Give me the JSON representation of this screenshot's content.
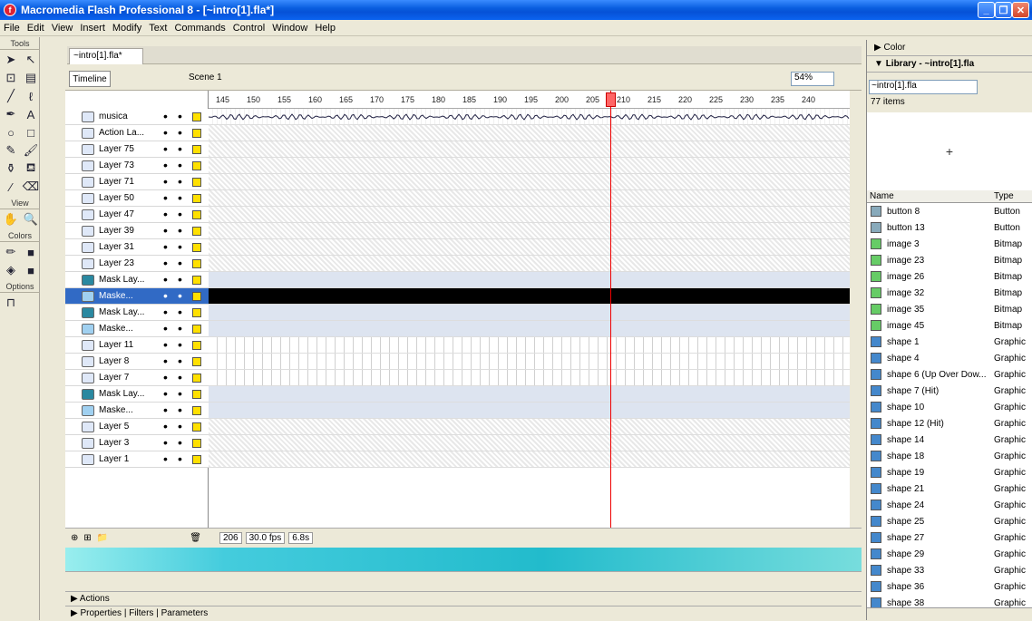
{
  "window": {
    "title": "Macromedia Flash Professional 8 - [~intro[1].fla*]"
  },
  "menu": [
    "File",
    "Edit",
    "View",
    "Insert",
    "Modify",
    "Text",
    "Commands",
    "Control",
    "Window",
    "Help"
  ],
  "tools": {
    "header": "Tools",
    "view_label": "View",
    "colors_label": "Colors",
    "options_label": "Options"
  },
  "doc": {
    "tab": "~intro[1].fla*",
    "timeline_btn": "Timeline",
    "scene": "Scene 1",
    "zoom": "54%"
  },
  "ruler": [
    "145",
    "150",
    "155",
    "160",
    "165",
    "170",
    "175",
    "180",
    "185",
    "190",
    "195",
    "200",
    "205",
    "210",
    "215",
    "220",
    "225",
    "230",
    "235",
    "240"
  ],
  "layers": [
    {
      "name": "musica",
      "kind": "normal"
    },
    {
      "name": "Action La...",
      "kind": "normal"
    },
    {
      "name": "Layer 75",
      "kind": "normal"
    },
    {
      "name": "Layer 73",
      "kind": "normal"
    },
    {
      "name": "Layer 71",
      "kind": "normal"
    },
    {
      "name": "Layer 50",
      "kind": "normal"
    },
    {
      "name": "Layer 47",
      "kind": "normal"
    },
    {
      "name": "Layer 39",
      "kind": "normal"
    },
    {
      "name": "Layer 31",
      "kind": "normal"
    },
    {
      "name": "Layer 23",
      "kind": "normal"
    },
    {
      "name": "Mask Lay...",
      "kind": "mask"
    },
    {
      "name": "Maske...",
      "kind": "masked",
      "selected": true
    },
    {
      "name": "Mask Lay...",
      "kind": "mask"
    },
    {
      "name": "Maske...",
      "kind": "masked"
    },
    {
      "name": "Layer 11",
      "kind": "normal"
    },
    {
      "name": "Layer 8",
      "kind": "normal"
    },
    {
      "name": "Layer 7",
      "kind": "normal"
    },
    {
      "name": "Mask Lay...",
      "kind": "mask"
    },
    {
      "name": "Maske...",
      "kind": "masked"
    },
    {
      "name": "Layer 5",
      "kind": "normal"
    },
    {
      "name": "Layer 3",
      "kind": "normal"
    },
    {
      "name": "Layer 1",
      "kind": "normal"
    }
  ],
  "timeline_footer": {
    "frame": "206",
    "fps": "30.0 fps",
    "time": "6.8s"
  },
  "panels": {
    "actions": "Actions",
    "properties": "Properties",
    "filters": "Filters",
    "parameters": "Parameters"
  },
  "right": {
    "color_hdr": "Color",
    "lib_hdr": "Library - ~intro[1].fla",
    "lib_select": "~intro[1].fla",
    "count": "77 items",
    "col_name": "Name",
    "col_type": "Type",
    "items": [
      {
        "name": "button 8",
        "type": "Button",
        "k": "btn"
      },
      {
        "name": "button 13",
        "type": "Button",
        "k": "btn"
      },
      {
        "name": "image 3",
        "type": "Bitmap",
        "k": "bmp"
      },
      {
        "name": "image 23",
        "type": "Bitmap",
        "k": "bmp"
      },
      {
        "name": "image 26",
        "type": "Bitmap",
        "k": "bmp"
      },
      {
        "name": "image 32",
        "type": "Bitmap",
        "k": "bmp"
      },
      {
        "name": "image 35",
        "type": "Bitmap",
        "k": "bmp"
      },
      {
        "name": "image 45",
        "type": "Bitmap",
        "k": "bmp"
      },
      {
        "name": "shape 1",
        "type": "Graphic",
        "k": "gfx"
      },
      {
        "name": "shape 4",
        "type": "Graphic",
        "k": "gfx"
      },
      {
        "name": "shape 6 (Up Over Dow...",
        "type": "Graphic",
        "k": "gfx"
      },
      {
        "name": "shape 7 (Hit)",
        "type": "Graphic",
        "k": "gfx"
      },
      {
        "name": "shape 10",
        "type": "Graphic",
        "k": "gfx"
      },
      {
        "name": "shape 12 (Hit)",
        "type": "Graphic",
        "k": "gfx"
      },
      {
        "name": "shape 14",
        "type": "Graphic",
        "k": "gfx"
      },
      {
        "name": "shape 18",
        "type": "Graphic",
        "k": "gfx"
      },
      {
        "name": "shape 19",
        "type": "Graphic",
        "k": "gfx"
      },
      {
        "name": "shape 21",
        "type": "Graphic",
        "k": "gfx"
      },
      {
        "name": "shape 24",
        "type": "Graphic",
        "k": "gfx"
      },
      {
        "name": "shape 25",
        "type": "Graphic",
        "k": "gfx"
      },
      {
        "name": "shape 27",
        "type": "Graphic",
        "k": "gfx"
      },
      {
        "name": "shape 29",
        "type": "Graphic",
        "k": "gfx"
      },
      {
        "name": "shape 33",
        "type": "Graphic",
        "k": "gfx"
      },
      {
        "name": "shape 36",
        "type": "Graphic",
        "k": "gfx"
      },
      {
        "name": "shape 38",
        "type": "Graphic",
        "k": "gfx"
      }
    ]
  }
}
